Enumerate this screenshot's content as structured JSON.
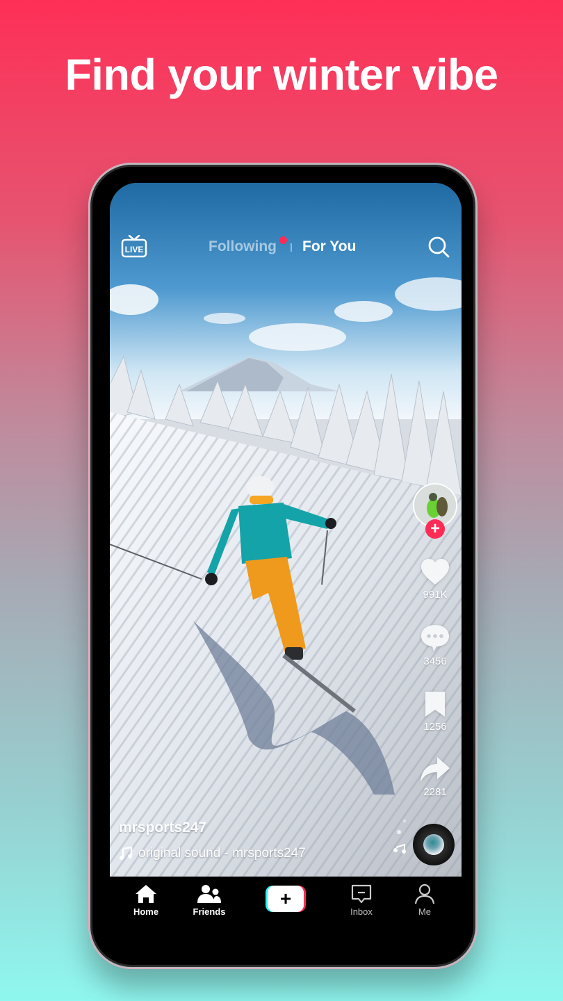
{
  "headline": "Find your winter vibe",
  "colors": {
    "brand_pink": "#fe2c55",
    "brand_cyan": "#25f4ee",
    "bg_top": "#fe2f57",
    "bg_bottom": "#8ff7ef"
  },
  "feed": {
    "live_icon": "live-tv-icon",
    "live_label": "LIVE",
    "tabs": [
      {
        "label": "Following",
        "active": false,
        "has_notification_dot": true
      },
      {
        "label": "For You",
        "active": true
      }
    ],
    "search_icon": "search-icon"
  },
  "video": {
    "username": "mrsports247",
    "sound": "original sound - mrsports247",
    "sound_icon": "music-note-icon"
  },
  "actions": {
    "follow_label": "+",
    "likes": "991K",
    "comments": "3456",
    "saves": "1256",
    "shares": "2281"
  },
  "nav": {
    "items": [
      {
        "label": "Home",
        "icon": "home-icon",
        "active": true
      },
      {
        "label": "Friends",
        "icon": "friends-icon",
        "active": true
      },
      {
        "label": "+",
        "icon": "create-icon"
      },
      {
        "label": "Inbox",
        "icon": "inbox-icon",
        "active": false
      },
      {
        "label": "Me",
        "icon": "profile-icon",
        "active": false
      }
    ]
  }
}
